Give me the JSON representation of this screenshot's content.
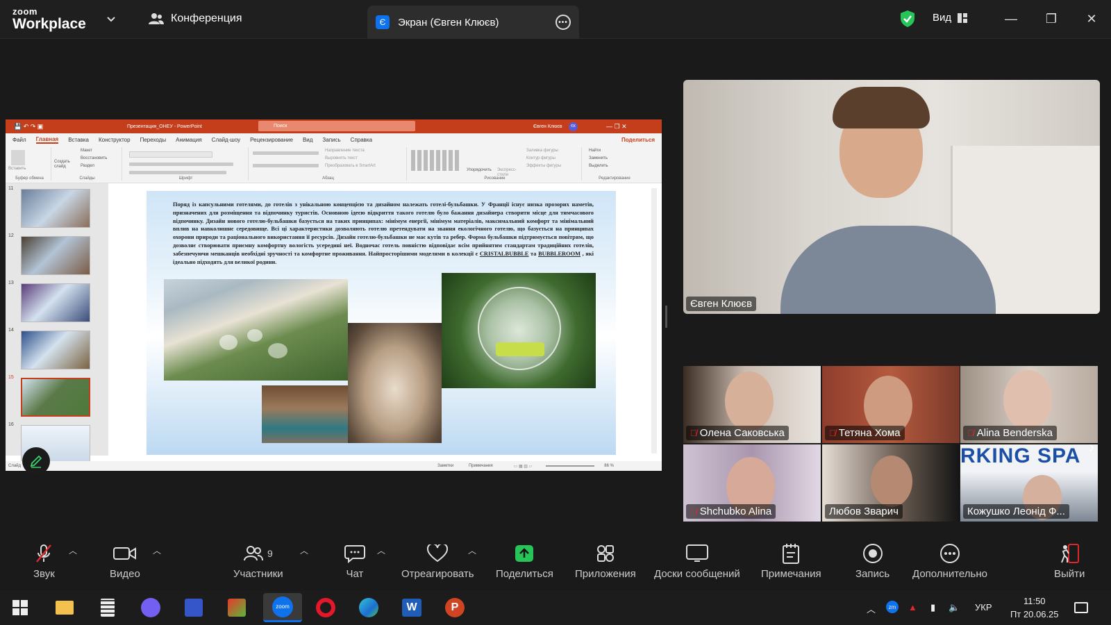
{
  "window": {
    "logo_top": "zoom",
    "logo_bottom": "Workplace",
    "conference_label": "Конференция",
    "screen_tab_badge": "Є",
    "screen_tab_label": "Экран (Євген Клюєв)",
    "view_label": "Вид"
  },
  "ppt": {
    "file_title": "Презентация_ОНЕУ - PowerPoint",
    "search": "Поиск",
    "user": "Євген Клюєв",
    "user_badge": "ЄК",
    "menu": [
      "Файл",
      "Главная",
      "Вставка",
      "Конструктор",
      "Переходы",
      "Анимация",
      "Слайд-шоу",
      "Рецензирование",
      "Вид",
      "Запись",
      "Справка"
    ],
    "share": "Поделиться",
    "ribbon_groups": [
      "Буфер обмена",
      "Слайды",
      "Шрифт",
      "Абзац",
      "Рисование",
      "Редактирование"
    ],
    "ribbon_items": {
      "paste": "Вставить",
      "create_slide": "Создать слайд",
      "layout": "Макет",
      "restore": "Восстановить",
      "section": "Раздел",
      "text_dir": "Направление текста",
      "align_text": "Выровнять текст",
      "smartart": "Преобразовать в SmartArt",
      "arrange": "Упорядочить",
      "quick_styles": "Экспресс-стили",
      "fill": "Заливка фигуры",
      "outline": "Контур фигуры",
      "effects": "Эффекты фигуры",
      "find": "Найти",
      "replace": "Заменить",
      "select": "Выделить"
    },
    "slide_numbers": [
      "11",
      "12",
      "13",
      "14",
      "15",
      "16"
    ],
    "selected_slide": "15",
    "slide_text_a": "Поряд із капсульними готелями, до готелів з унікальною концепцією та дизайном належать готелі-бульбашки. У Франції існує низка прозорих наметів, призначених для розміщення та відпочинку туристів. Основною ідеєю відкриття такого готелю було бажання дизайнера створити місце для тимчасового відпочинку. Дизайн нового готелю-бульбашки базується на таких принципах: мінімум енергії, мінімум матеріалів, максимальний комфорт та мінімальний вплив на навколишнє середовище. Всі ці характеристики дозволяють готелю претендувати на звання екологічного готелю, що базується на принципах охорони природи та раціонального використання її ресурсів. Дизайн готелю-бульбашки не має кутів та ребер. Форма бульбашки підтримується повітрям, що дозволяє створювати приємну комфортну вологість усередині неї. Водночас готель повністю відповідає всім прийнятим стандартам традиційних готелів, забезпечуючи мешканців необхідні зручності та комфортне проживання. Найпросторішими моделями в колекції є ",
    "brand1": "CRISTALBUBBLE",
    "slide_text_and": " та ",
    "brand2": "BUBBLEROOM",
    "slide_text_b": " , які ідеально підходять для великої родини.",
    "status_slide": "Слайд",
    "status_notes": "Заметки",
    "status_comments": "Примечания",
    "zoom_level": "86 %"
  },
  "video": {
    "speaker": "Євген Клюєв",
    "participants": [
      {
        "name": "Олена Саковська",
        "muted": true
      },
      {
        "name": "Тетяна Хома",
        "muted": true
      },
      {
        "name": "Alina Benderska",
        "muted": true
      },
      {
        "name": "Shchubko Alina",
        "muted": true
      },
      {
        "name": "Любов Зварич",
        "muted": false
      },
      {
        "name": "Кожушко Леонід Ф...",
        "muted": false
      }
    ],
    "banner_text": "RKING SPA"
  },
  "toolbar": {
    "audio": "Звук",
    "video": "Видео",
    "participants": "Участники",
    "participants_count": "9",
    "chat": "Чат",
    "react": "Отреагировать",
    "share": "Поделиться",
    "apps": "Приложения",
    "whiteboards": "Доски сообщений",
    "notes": "Примечания",
    "record": "Запись",
    "more": "Дополнительно",
    "leave": "Выйти"
  },
  "taskbar": {
    "lang": "УКР",
    "time": "11:50",
    "date": "Пт 20.06.25"
  },
  "colors": {
    "zoom_blue": "#0e72ed",
    "share_green": "#27c45a",
    "ppt_red": "#c43e1c",
    "mute_red": "#e02828",
    "leave_red": "#e02828"
  }
}
